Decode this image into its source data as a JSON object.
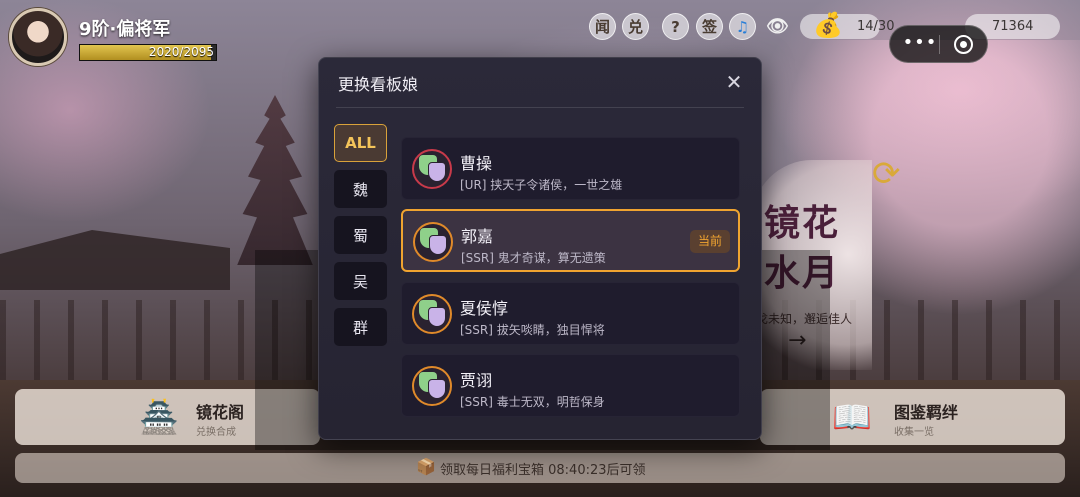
{
  "player": {
    "rank": "9阶·偏将军",
    "exp_text": "2020/2095",
    "exp_fraction": 0.964
  },
  "top_icons": [
    {
      "label": "闻",
      "name": "news-icon"
    },
    {
      "label": "兑",
      "name": "exchange-icon"
    },
    {
      "label": "?",
      "name": "help-icon"
    },
    {
      "label": "签",
      "name": "checkin-icon"
    },
    {
      "label": "♫",
      "name": "music-icon"
    },
    {
      "label": "👁",
      "name": "eye-icon"
    }
  ],
  "resources": {
    "bag_count": "14/30",
    "coins": "71364"
  },
  "capsule": {
    "dots": "•••"
  },
  "modal": {
    "title": "更换看板娘",
    "close": "✕",
    "filters": [
      "ALL",
      "魏",
      "蜀",
      "吴",
      "群"
    ],
    "active_filter": 0,
    "items": [
      {
        "name": "曹操",
        "desc": "[UR] 挟天子令诸侯，一世之雄",
        "rarity": "UR",
        "current": false
      },
      {
        "name": "郭嘉",
        "desc": "[SSR] 鬼才奇谋，算无遗策",
        "rarity": "SSR",
        "current": true,
        "badge": "当前"
      },
      {
        "name": "夏侯惇",
        "desc": "[SSR] 拔矢啖睛，独目悍将",
        "rarity": "SSR",
        "current": false
      },
      {
        "name": "贾诩",
        "desc": "[SSR] 毒士无双，明哲保身",
        "rarity": "SSR",
        "current": false
      }
    ]
  },
  "mirror": {
    "title": "镜花水月",
    "subtitle": "戈未知，邂逅佳人",
    "arrow": "→"
  },
  "cards": {
    "left": {
      "title": "镜花阁",
      "sub": "兑换合成"
    },
    "right": {
      "title": "图鉴羁绊",
      "sub": "收集一览"
    }
  },
  "daily": {
    "text": "领取每日福利宝箱  08:40:23后可领"
  },
  "colors": {
    "accent": "#f0a430",
    "modal_bg": "#2b2939",
    "item_bg": "#1f1c2d",
    "ur_border": "#c83a4a"
  }
}
